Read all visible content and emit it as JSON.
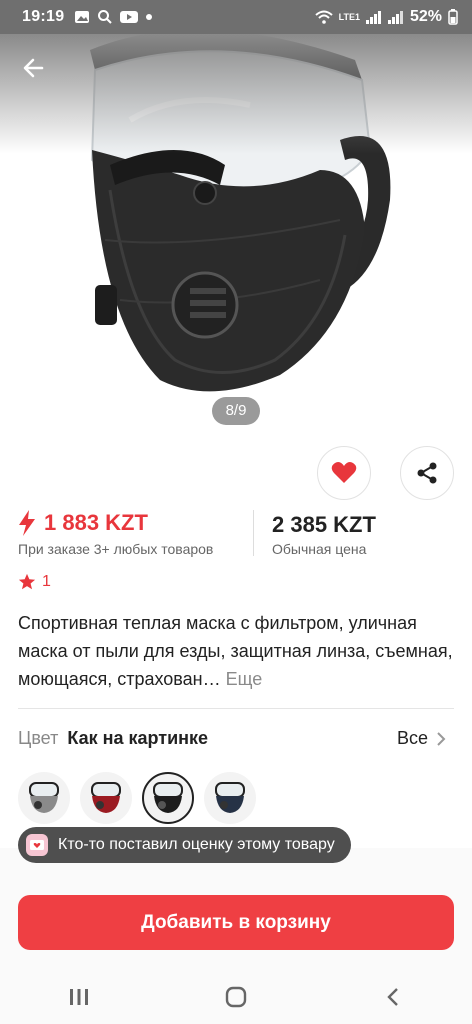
{
  "status_bar": {
    "time": "19:19",
    "battery": "52%",
    "network": "LTE1"
  },
  "hero": {
    "pager": "8/9"
  },
  "price": {
    "main": "1 883 KZT",
    "main_note": "При заказе 3+ любых товаров",
    "regular": "2 385 KZT",
    "regular_note": "Обычная цена"
  },
  "rating": {
    "count": "1"
  },
  "description": {
    "text": "Спортивная теплая маска с фильтром, уличная маска от пыли для езды, защитная линза, съемная, моющаяся, страхован…",
    "more": "Еще"
  },
  "color": {
    "label": "Цвет",
    "value": "Как на картинке",
    "all": "Все"
  },
  "swatches": [
    {
      "color": "#8a8a8a",
      "selected": false
    },
    {
      "color": "#9b1b22",
      "selected": false
    },
    {
      "color": "#1d1d1d",
      "selected": true
    },
    {
      "color": "#263246",
      "selected": false
    }
  ],
  "toast": {
    "text": "Кто-то поставил оценку этому товару"
  },
  "cart": {
    "label": "Добавить в корзину"
  },
  "colors": {
    "accent": "#e8363c",
    "button": "#ef3f43"
  }
}
